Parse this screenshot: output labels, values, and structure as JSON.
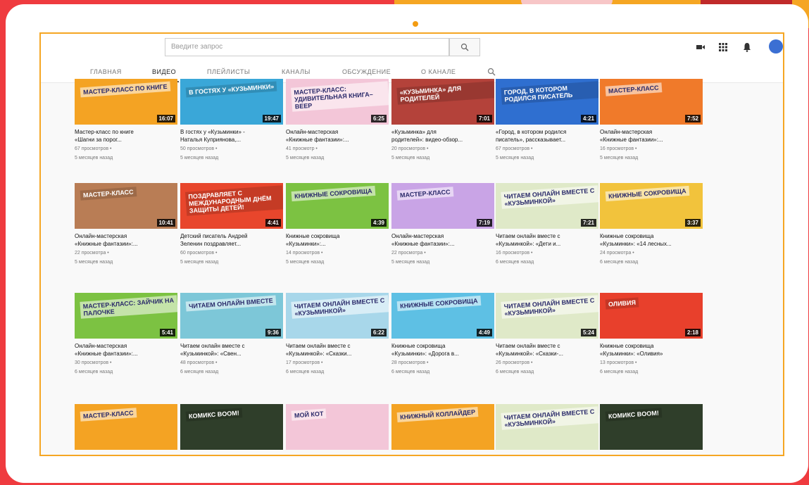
{
  "topbar": {
    "search_placeholder": "Введите запрос"
  },
  "tabs": [
    {
      "label": "ГЛАВНАЯ"
    },
    {
      "label": "ВИДЕО"
    },
    {
      "label": "ПЛЕЙЛИСТЫ"
    },
    {
      "label": "КАНАЛЫ"
    },
    {
      "label": "ОБСУЖДЕНИЕ"
    },
    {
      "label": "О КАНАЛЕ"
    }
  ],
  "videos": [
    {
      "thumb_text": "МАСТЕР-КЛАСС ПО КНИГЕ",
      "color": "#f4a323",
      "duration": "16:07",
      "title1": "Мастер-класс по книге",
      "title2": "«Шагни за порог...",
      "views": "67 просмотров •",
      "age": "5 месяцев назад"
    },
    {
      "thumb_text": "В ГОСТЯХ У «КУЗЬМИНКИ»",
      "color": "#3aa7d8",
      "duration": "19:47",
      "title1": "В гостях у «Кузьминки» -",
      "title2": "Наталья Куприянова,...",
      "views": "50 просмотров •",
      "age": "5 месяцев назад"
    },
    {
      "thumb_text": "МАСТЕР-КЛАСС: УДИВИТЕЛЬНАЯ КНИГА–ВЕЕР",
      "color": "#f3c6d8",
      "duration": "6:25",
      "title1": "Онлайн-мастерская",
      "title2": "«Книжные фантазии»:...",
      "views": "41 просмотр •",
      "age": "5 месяцев назад"
    },
    {
      "thumb_text": "«КУЗЬМИНКА» ДЛЯ РОДИТЕЛЕЙ",
      "color": "#b4423a",
      "duration": "7:01",
      "title1": "«Кузьминка» для",
      "title2": "родителей»: видео-обзор...",
      "views": "20 просмотров •",
      "age": "5 месяцев назад"
    },
    {
      "thumb_text": "ГОРОД, В КОТОРОМ РОДИЛСЯ ПИСАТЕЛЬ",
      "color": "#2f6fd0",
      "duration": "4:21",
      "title1": "«Город, в котором родился",
      "title2": "писатель», рассказывает...",
      "views": "67 просмотров •",
      "age": "5 месяцев назад"
    },
    {
      "thumb_text": "МАСТЕР-КЛАСС",
      "color": "#f07a2a",
      "duration": "7:52",
      "title1": "Онлайн-мастерская",
      "title2": "«Книжные фантазии»:...",
      "views": "16 просмотров •",
      "age": "5 месяцев назад"
    },
    {
      "thumb_text": "МАСТЕР-КЛАСС",
      "color": "#b97d55",
      "duration": "10:41",
      "title1": "Онлайн-мастерская",
      "title2": "«Книжные фантазии»:...",
      "views": "22 просмотра •",
      "age": "5 месяцев назад"
    },
    {
      "thumb_text": "ПОЗДРАВЛЯЕТ С МЕЖДУНАРОДНЫМ ДНЁМ ЗАЩИТЫ ДЕТЕЙ!",
      "color": "#e8462c",
      "duration": "4:41",
      "title1": "Детский писатель Андрей",
      "title2": "Зеленин поздравляет...",
      "views": "60 просмотров •",
      "age": "5 месяцев назад"
    },
    {
      "thumb_text": "КНИЖНЫЕ СОКРОВИЩА",
      "color": "#7cc242",
      "duration": "4:39",
      "title1": "Книжные сокровища",
      "title2": "«Кузьминки»:...",
      "views": "14 просмотров •",
      "age": "5 месяцев назад"
    },
    {
      "thumb_text": "МАСТЕР-КЛАСС",
      "color": "#c9a4e6",
      "duration": "7:19",
      "title1": "Онлайн-мастерская",
      "title2": "«Книжные фантазии»:...",
      "views": "22 просмотра •",
      "age": "5 месяцев назад"
    },
    {
      "thumb_text": "ЧИТАЕМ ОНЛАЙН ВМЕСТЕ С «КУЗЬМИНКОЙ»",
      "color": "#dfe9c8",
      "duration": "7:21",
      "title1": "Читаем онлайн вместе с",
      "title2": "«Кузьминкой»: «Дети и...",
      "views": "16 просмотров •",
      "age": "6 месяцев назад"
    },
    {
      "thumb_text": "КНИЖНЫЕ СОКРОВИЩА",
      "color": "#f2c33c",
      "duration": "3:37",
      "title1": "Книжные сокровища",
      "title2": "«Кузьминки»: «14 лесных...",
      "views": "24 просмотра •",
      "age": "6 месяцев назад"
    },
    {
      "thumb_text": "МАСТЕР-КЛАСС: ЗАЙЧИК НА ПАЛОЧКЕ",
      "color": "#7cc242",
      "duration": "5:41",
      "title1": "Онлайн-мастерская",
      "title2": "«Книжные фантазии»:...",
      "views": "30 просмотров •",
      "age": "6 месяцев назад"
    },
    {
      "thumb_text": "ЧИТАЕМ ОНЛАЙН ВМЕСТЕ",
      "color": "#7dc7d8",
      "duration": "9:36",
      "title1": "Читаем онлайн вместе с",
      "title2": "«Кузьминкой»: «Свен...",
      "views": "48 просмотров •",
      "age": "6 месяцев назад"
    },
    {
      "thumb_text": "ЧИТАЕМ ОНЛАЙН ВМЕСТЕ С «КУЗЬМИНКОЙ»",
      "color": "#a8d7ea",
      "duration": "6:22",
      "title1": "Читаем онлайн вместе с",
      "title2": "«Кузьминкой»: «Сказки...",
      "views": "17 просмотров •",
      "age": "6 месяцев назад"
    },
    {
      "thumb_text": "КНИЖНЫЕ СОКРОВИЩА",
      "color": "#5ec0e4",
      "duration": "4:49",
      "title1": "Книжные сокровища",
      "title2": "«Кузьминки»: «Дорога в...",
      "views": "28 просмотров •",
      "age": "6 месяцев назад"
    },
    {
      "thumb_text": "ЧИТАЕМ ОНЛАЙН ВМЕСТЕ С «КУЗЬМИНКОЙ»",
      "color": "#dfe9c8",
      "duration": "5:24",
      "title1": "Читаем онлайн вместе с",
      "title2": "«Кузьминкой»: «Сказки-...",
      "views": "26 просмотров •",
      "age": "6 месяцев назад"
    },
    {
      "thumb_text": "ОЛИВИЯ",
      "color": "#e8402c",
      "duration": "2:18",
      "title1": "Книжные сокровища",
      "title2": "«Кузьминки»: «Оливия»",
      "views": "13 просмотров •",
      "age": "6 месяцев назад"
    },
    {
      "thumb_text": "МАСТЕР-КЛАСС",
      "color": "#f4a323",
      "duration": "",
      "title1": "",
      "title2": "",
      "views": "",
      "age": ""
    },
    {
      "thumb_text": "КОМИКС BOOM!",
      "color": "#2f3e2a",
      "duration": "",
      "title1": "",
      "title2": "",
      "views": "",
      "age": ""
    },
    {
      "thumb_text": "МОЙ КОТ",
      "color": "#f3c6d8",
      "duration": "",
      "title1": "",
      "title2": "",
      "views": "",
      "age": ""
    },
    {
      "thumb_text": "КНИЖНЫЙ КОЛЛАЙДЕР",
      "color": "#f4a323",
      "duration": "",
      "title1": "",
      "title2": "",
      "views": "",
      "age": ""
    },
    {
      "thumb_text": "ЧИТАЕМ ОНЛАЙН ВМЕСТЕ С «КУЗЬМИНКОЙ»",
      "color": "#dfe9c8",
      "duration": "",
      "title1": "",
      "title2": "",
      "views": "",
      "age": ""
    },
    {
      "thumb_text": "КОМИКС BOOM!",
      "color": "#2f3e2a",
      "duration": "",
      "title1": "",
      "title2": "",
      "views": "",
      "age": ""
    }
  ]
}
